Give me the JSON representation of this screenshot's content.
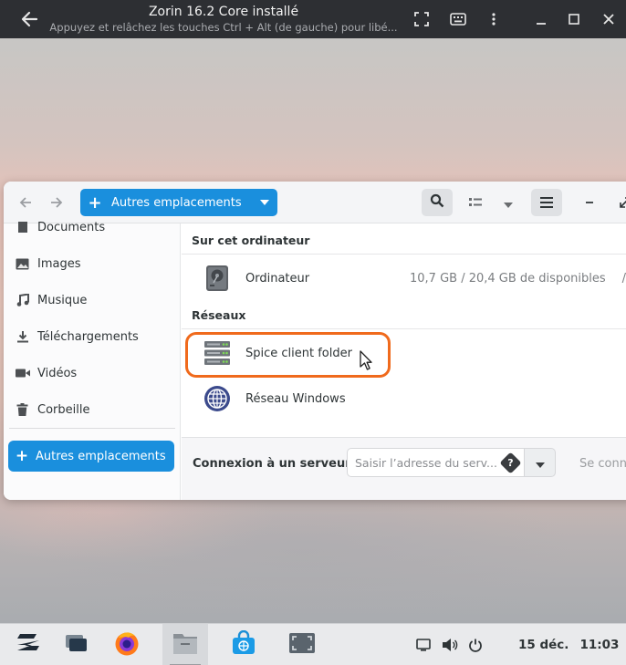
{
  "viewer": {
    "title": "Zorin 16.2 Core installé",
    "subtitle": "Appuyez et relâchez les touches Ctrl + Alt (de gauche) pour libé..."
  },
  "toolbar": {
    "path_label": "Autres emplacements",
    "path_plus": "+"
  },
  "sidebar": {
    "items": [
      {
        "label": "Documents",
        "icon": "document-icon"
      },
      {
        "label": "Images",
        "icon": "image-icon"
      },
      {
        "label": "Musique",
        "icon": "music-icon"
      },
      {
        "label": "Téléchargements",
        "icon": "download-icon"
      },
      {
        "label": "Vidéos",
        "icon": "video-icon"
      },
      {
        "label": "Corbeille",
        "icon": "trash-icon"
      }
    ],
    "active": {
      "label": "Autres emplacements",
      "plus": "+"
    }
  },
  "main": {
    "section_computer": "Sur cet ordinateur",
    "computer": {
      "name": "Ordinateur",
      "info": "10,7 GB / 20,4 GB de disponibles",
      "path": "/"
    },
    "section_networks": "Réseaux",
    "networks": [
      {
        "name": "Spice client folder",
        "icon": "server-icon"
      },
      {
        "name": "Réseau Windows",
        "icon": "globe-icon"
      }
    ]
  },
  "connect": {
    "label": "Connexion à un serveur",
    "placeholder": "Saisir l’adresse du serv...",
    "help": "?",
    "button": "Se conn"
  },
  "taskbar": {
    "date": "15 déc.",
    "time": "11:03"
  },
  "colors": {
    "accent": "#1a8fdd",
    "highlight": "#f06a1c"
  }
}
